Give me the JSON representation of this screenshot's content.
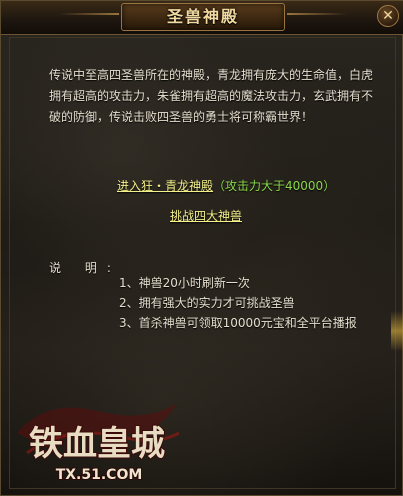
{
  "window": {
    "title": "圣兽神殿",
    "close_label": "✕"
  },
  "lore_text": "传说中至高四圣兽所在的神殿，青龙拥有庞大的生命值，白虎拥有超高的攻击力，朱雀拥有超高的魔法攻击力，玄武拥有不破的防御，传说击败四圣兽的勇士将可称霸世界！",
  "actions": {
    "enter_link": "进入狂・青龙神殿",
    "enter_note": "（攻击力大于40000）",
    "challenge_link": "挑战四大神兽"
  },
  "notes": {
    "label": "说 明:",
    "items": [
      "1、神兽20小时刷新一次",
      "2、拥有强大的实力才可挑战圣兽",
      "3、首杀神兽可领取10000元宝和全平台播报"
    ]
  },
  "logo": {
    "name_text": "铁血皇城",
    "url_text": "TX.51.COM"
  },
  "colors": {
    "title": "#f2d9a0",
    "body_text": "#e6dfcf",
    "link": "#f4f08a",
    "note_green": "#8ad84a",
    "logo_red": "#b8231c"
  }
}
